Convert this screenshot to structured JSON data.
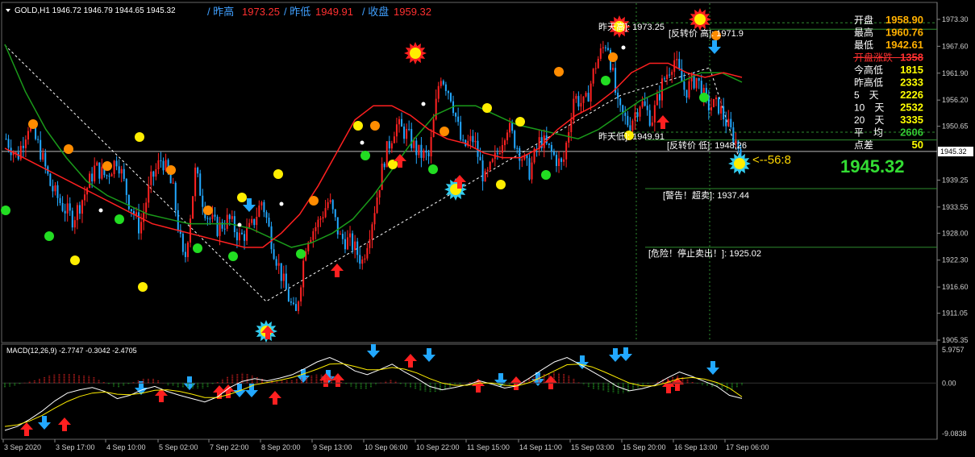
{
  "header": {
    "symbol_line": "GOLD,H1  1946.72 1946.79 1944.65 1945.32",
    "prev_high_label": "/ 昨高",
    "prev_high_value": "1973.25",
    "prev_low_label": "/ 昨低",
    "prev_low_value": "1949.91",
    "close_label": "/ 收盘",
    "close_value": "1959.32"
  },
  "stats": [
    {
      "label": "开盘",
      "value": "1958.90",
      "color": "#ffb000"
    },
    {
      "label": "最高",
      "value": "1960.76",
      "color": "#ffb000"
    },
    {
      "label": "最低",
      "value": "1942.61",
      "color": "#ffb000"
    },
    {
      "label": "开盘涨跌",
      "value": "1358",
      "color": "#ff3030",
      "strike": true
    },
    {
      "label": "今高低",
      "value": "1815",
      "color": "#ffff00"
    },
    {
      "label": "昨高低",
      "value": "2333",
      "color": "#ffff00"
    },
    {
      "label": "5　天",
      "value": "2226",
      "color": "#ffff00"
    },
    {
      "label": "10　天",
      "value": "2532",
      "color": "#ffff00"
    },
    {
      "label": "20　天",
      "value": "3335",
      "color": "#ffff00"
    },
    {
      "label": "平　均",
      "value": "2606",
      "color": "#33cc33"
    },
    {
      "label": "点差",
      "value": "50",
      "color": "#ffff00"
    }
  ],
  "big_price": "1945.32",
  "countdown": "<--56:8",
  "levels": {
    "prev_high": {
      "text": "昨天高]: 1973.25",
      "value": 1973.25
    },
    "rev_high": {
      "text": "[反转价 高]: 1971.9",
      "value": 1971.9
    },
    "prev_low": {
      "text": "昨天低]: 1949.91",
      "value": 1949.91
    },
    "rev_low": {
      "text": "[反转价 低]: 1948.26",
      "value": 1948.26
    },
    "warn": {
      "text": "[警告！超卖]: 1937.44",
      "value": 1937.44
    },
    "danger": {
      "text": "[危险！停止卖出！]: 1925.02",
      "value": 1925.02
    }
  },
  "current_price_tag": "1945.32",
  "macd_label": "MACD(12,26,9) -2.7747 -0.3042 -2.4705",
  "chart_data": {
    "type": "candlestick",
    "symbol": "GOLD",
    "timeframe": "H1",
    "ylim": [
      1905.35,
      1976
    ],
    "y_ticks": [
      "1973.30",
      "1967.60",
      "1961.90",
      "1956.20",
      "1950.65",
      "1945.32",
      "1939.25",
      "1933.55",
      "1928.00",
      "1922.30",
      "1916.60",
      "1911.05",
      "1905.35"
    ],
    "x_ticks": [
      "3 Sep 2020",
      "3 Sep 17:00",
      "4 Sep 10:00",
      "5 Sep 02:00",
      "7 Sep 22:00",
      "8 Sep 20:00",
      "9 Sep 13:00",
      "10 Sep 06:00",
      "10 Sep 22:00",
      "11 Sep 15:00",
      "14 Sep 11:00",
      "15 Sep 03:00",
      "15 Sep 20:00",
      "16 Sep 13:00",
      "17 Sep 06:00"
    ],
    "close_path": [
      1948,
      1944,
      1951,
      1946,
      1938,
      1934,
      1931,
      1936,
      1942,
      1940,
      1944,
      1935,
      1929,
      1939,
      1944,
      1937,
      1921,
      1941,
      1932,
      1929,
      1931,
      1927,
      1929,
      1935,
      1925,
      1917,
      1910,
      1927,
      1930,
      1935,
      1927,
      1926,
      1922,
      1932,
      1944,
      1951,
      1949,
      1945,
      1944,
      1962,
      1957,
      1946,
      1948,
      1939,
      1944,
      1951,
      1946,
      1941,
      1948,
      1945,
      1942,
      1957,
      1955,
      1964,
      1969,
      1954,
      1951,
      1956,
      1952,
      1960,
      1965,
      1958,
      1961,
      1955,
      1955,
      1950,
      1945.32
    ],
    "ma_red": [
      1946,
      1944,
      1942,
      1940,
      1938,
      1936,
      1934,
      1932,
      1930,
      1929,
      1928,
      1927,
      1926,
      1925,
      1925,
      1928,
      1932,
      1938,
      1945,
      1952,
      1955,
      1955,
      1953,
      1950,
      1948,
      1947,
      1945,
      1944,
      1944,
      1946,
      1950,
      1953,
      1955,
      1958,
      1962,
      1964,
      1964,
      1962,
      1961,
      1962,
      1961
    ],
    "ma_green": [
      1968,
      1958,
      1950,
      1944,
      1939,
      1936,
      1934,
      1932,
      1931,
      1930,
      1930,
      1930,
      1929,
      1927,
      1925,
      1926,
      1928,
      1931,
      1936,
      1942,
      1948,
      1953,
      1955,
      1955,
      1953,
      1951,
      1950,
      1949,
      1948,
      1950,
      1953,
      1956,
      1958,
      1960,
      1962,
      1962,
      1960
    ],
    "macd_ylim": [
      -9.0838,
      5.9757
    ],
    "macd_ticks": [
      "5.9757",
      "0.00",
      "-9.0838"
    ],
    "macd_line": [
      -8.5,
      -7.8,
      -6.5,
      -5,
      -3.2,
      -1.8,
      -1.2,
      -0.8,
      -1.5,
      -2.8,
      -2.2,
      -1.2,
      -0.6,
      -1.5,
      -2.2,
      -2.8,
      -3.4,
      -2.5,
      -0.8,
      0.3,
      0.8,
      0.4,
      0.9,
      1.5,
      2.6,
      3.8,
      4.6,
      3.6,
      2.2,
      1.5,
      2.4,
      3.4,
      2.0,
      0.8,
      -0.6,
      -1.2,
      -0.8,
      -0.3,
      0.4,
      -0.2,
      -0.9,
      -0.5,
      0.9,
      2.4,
      3.8,
      4.6,
      3.4,
      2.1,
      0.8,
      -0.6,
      -1.4,
      -1.0,
      -0.4,
      0.9,
      2.0,
      1.2,
      0.3,
      -0.6,
      -2.2,
      -2.7747
    ],
    "signal_line": [
      -7.8,
      -7.5,
      -6.8,
      -5.8,
      -4.5,
      -3.3,
      -2.4,
      -1.8,
      -1.6,
      -2.0,
      -2.1,
      -1.8,
      -1.3,
      -1.2,
      -1.5,
      -2.0,
      -2.6,
      -2.6,
      -2.0,
      -1.2,
      -0.3,
      0.1,
      0.5,
      1.0,
      1.7,
      2.5,
      3.4,
      3.5,
      3.0,
      2.4,
      2.4,
      2.8,
      2.5,
      1.8,
      0.8,
      0,
      -0.4,
      -0.4,
      0,
      0,
      -0.4,
      -0.5,
      0.1,
      1.1,
      2.2,
      3.3,
      3.4,
      2.9,
      2.0,
      1.0,
      0,
      -0.5,
      -0.5,
      0.1,
      0.8,
      1.0,
      0.7,
      0.1,
      -0.9,
      -2.4705
    ],
    "series": [
      {
        "name": "GOLD,H1"
      },
      {
        "name": "MACD(12,26,9)"
      }
    ]
  },
  "colors": {
    "up": "#ff2222",
    "down": "#22a8ff",
    "ma_red": "#ff2020",
    "ma_green": "#1a9a1a",
    "grid": "#2a4a2a",
    "axis_text": "#d0d0d0"
  }
}
